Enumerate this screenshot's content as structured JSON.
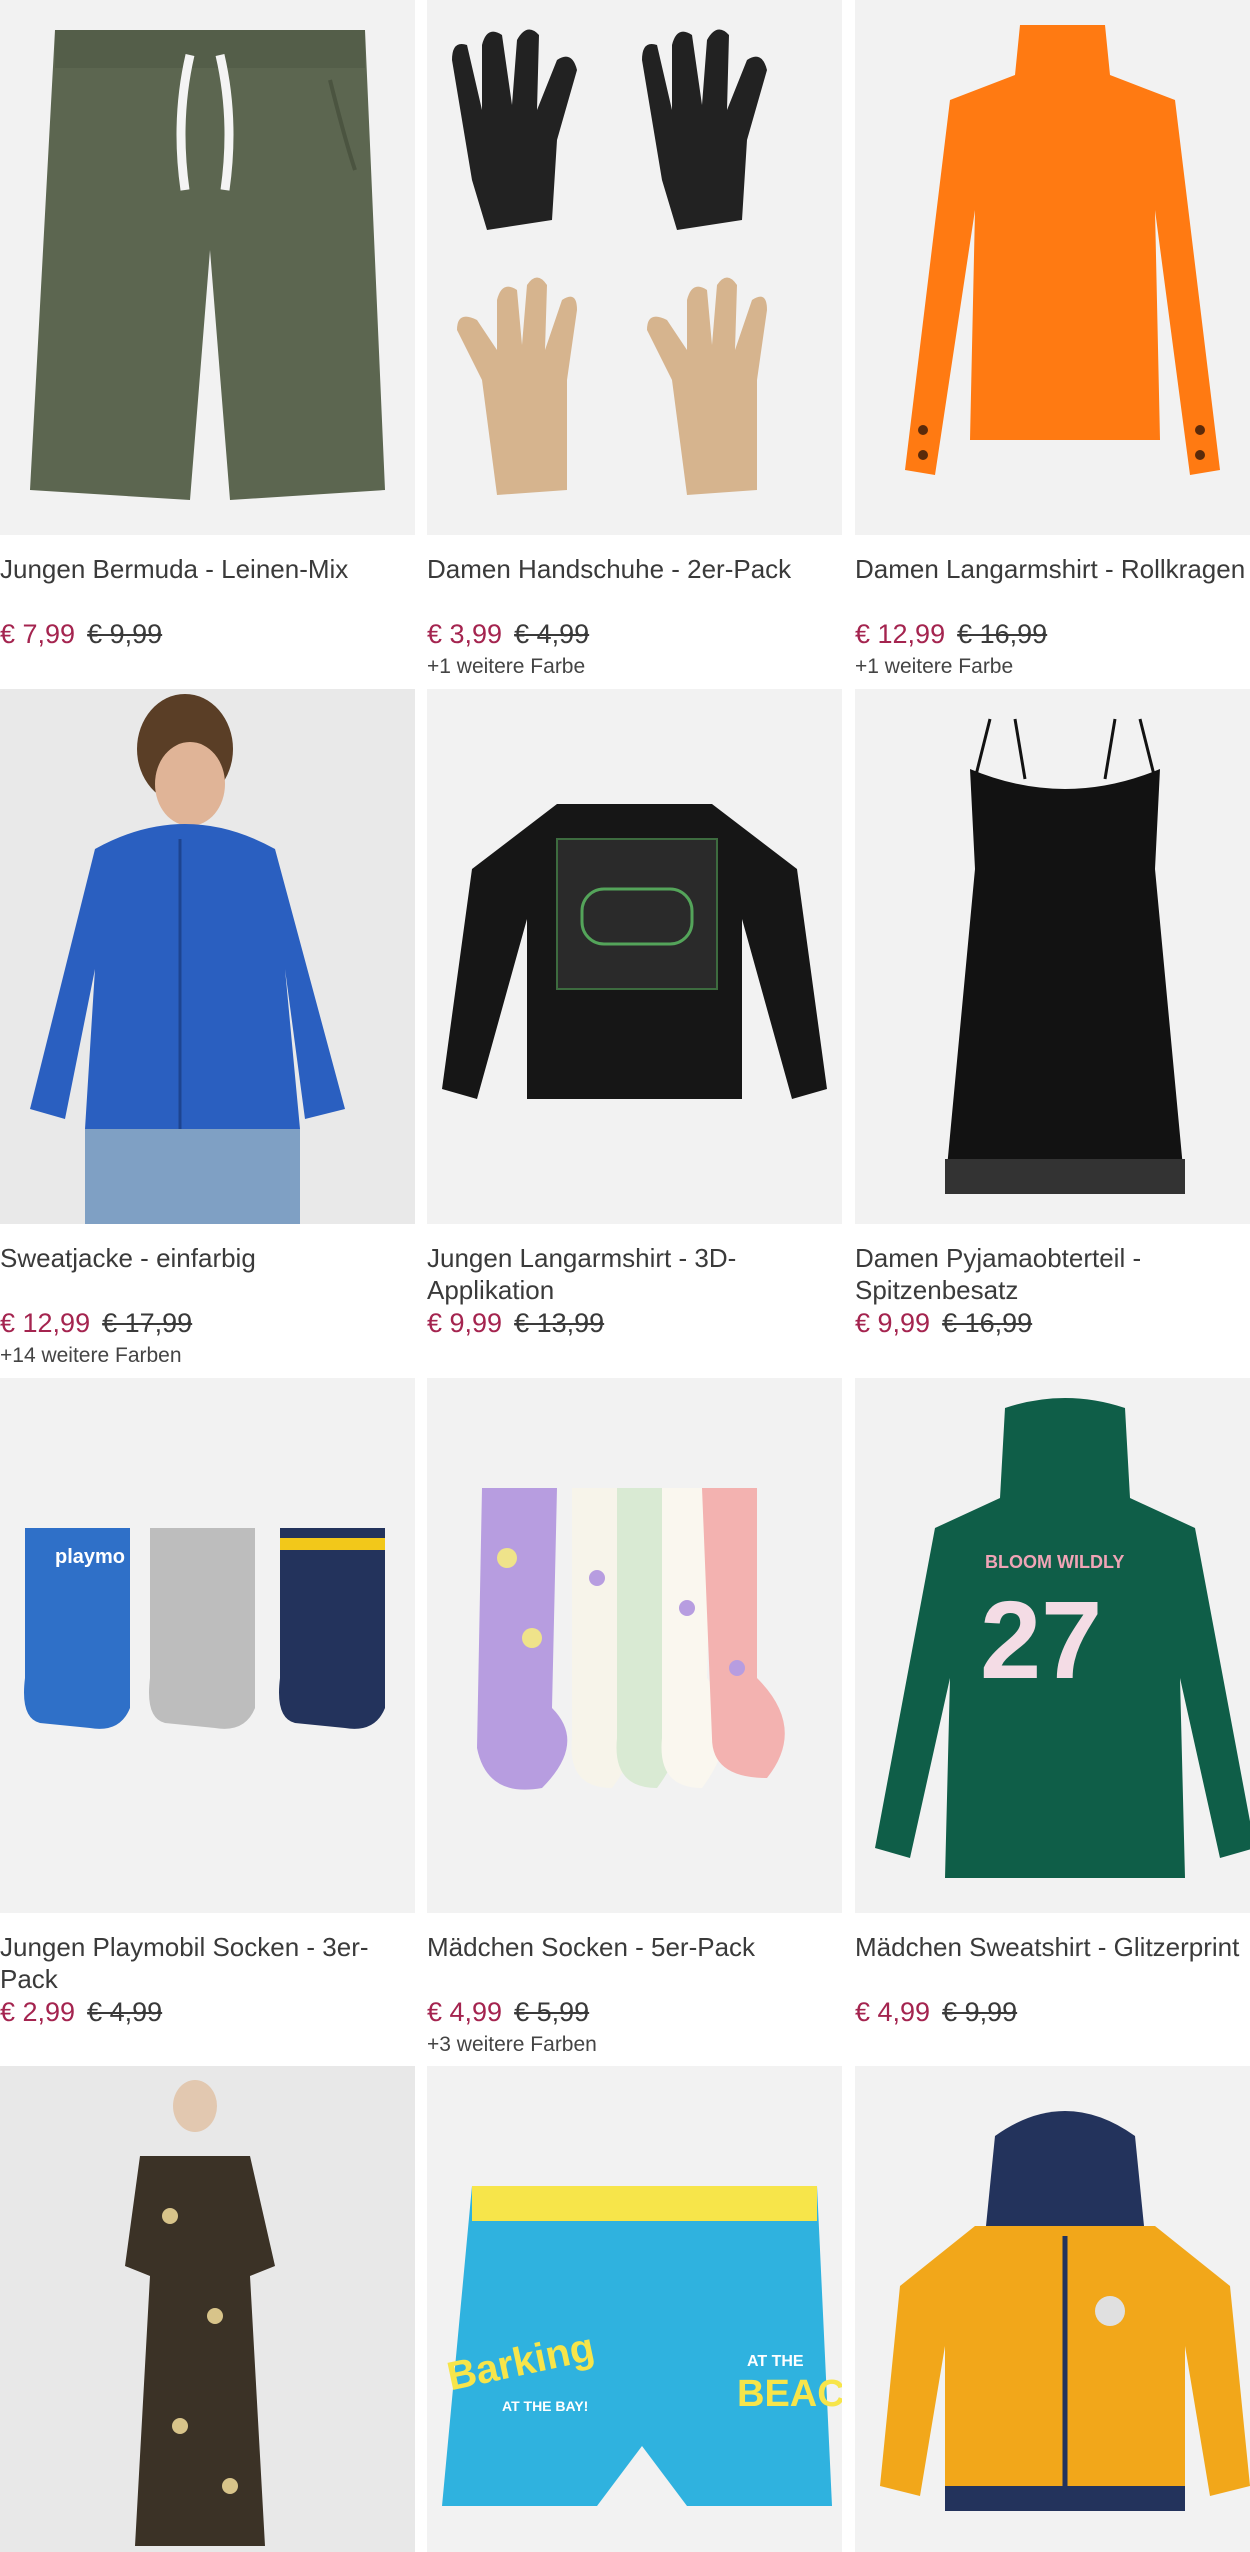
{
  "products": [
    {
      "title": "Jungen Bermuda - Leinen-Mix",
      "price": "€ 7,99",
      "old_price": "€ 9,99",
      "more": ""
    },
    {
      "title": "Damen Handschuhe - 2er-Pack",
      "price": "€ 3,99",
      "old_price": "€ 4,99",
      "more": "+1 weitere Farbe"
    },
    {
      "title": "Damen Langarmshirt - Rollkragen",
      "price": "€ 12,99",
      "old_price": "€ 16,99",
      "more": "+1 weitere Farbe"
    },
    {
      "title": "Sweatjacke - einfarbig",
      "price": "€ 12,99",
      "old_price": "€ 17,99",
      "more": "+14 weitere Farben"
    },
    {
      "title": "Jungen Langarmshirt - 3D-Applikation",
      "price": "€ 9,99",
      "old_price": "€ 13,99",
      "more": ""
    },
    {
      "title": "Damen Pyjamaobterteil - Spitzenbesatz",
      "price": "€ 9,99",
      "old_price": "€ 16,99",
      "more": ""
    },
    {
      "title": "Jungen Playmobil Socken - 3er-Pack",
      "price": "€ 2,99",
      "old_price": "€ 4,99",
      "more": ""
    },
    {
      "title": "Mädchen Socken - 5er-Pack",
      "price": "€ 4,99",
      "old_price": "€ 5,99",
      "more": "+3 weitere Farben"
    },
    {
      "title": "Mädchen Sweatshirt - Glitzerprint",
      "price": "€ 4,99",
      "old_price": "€ 9,99",
      "more": ""
    },
    {
      "title": "",
      "price": "",
      "old_price": "",
      "more": ""
    },
    {
      "title": "",
      "price": "",
      "old_price": "",
      "more": ""
    },
    {
      "title": "",
      "price": "",
      "old_price": "",
      "more": ""
    }
  ],
  "images": {
    "p0": {
      "icon": "bermuda-shorts-image",
      "color": "#5c6650"
    },
    "p1": {
      "icon": "gloves-image",
      "color": "#222222"
    },
    "p2": {
      "icon": "turtleneck-image",
      "color": "#ff7a12"
    },
    "p3": {
      "icon": "hoodie-jacket-image",
      "color": "#2a5fc0"
    },
    "p4": {
      "icon": "longsleeve-image",
      "color": "#161616"
    },
    "p5": {
      "icon": "slip-dress-image",
      "color": "#121212"
    },
    "p6": {
      "icon": "socks-playmobil-image",
      "color": "#2f70c8"
    },
    "p7": {
      "icon": "socks-dots-image",
      "color": "#b79de0"
    },
    "p8": {
      "icon": "sweatshirt-image",
      "color": "#0f5e48"
    },
    "p9": {
      "icon": "dress-image",
      "color": "#3b3226"
    },
    "p10": {
      "icon": "swim-shorts-image",
      "color": "#2fb2df"
    },
    "p11": {
      "icon": "jacket-image",
      "color": "#f2a71a"
    }
  },
  "sample_text": {
    "sweatshirt_print": "BLOOM WILDLY",
    "sweatshirt_number": "27",
    "swim_text_1": "Barking",
    "swim_text_2": "AT THE BAY!",
    "swim_text_3": "AT THE",
    "swim_text_4": "BEAC",
    "sock_brand": "playmo"
  }
}
